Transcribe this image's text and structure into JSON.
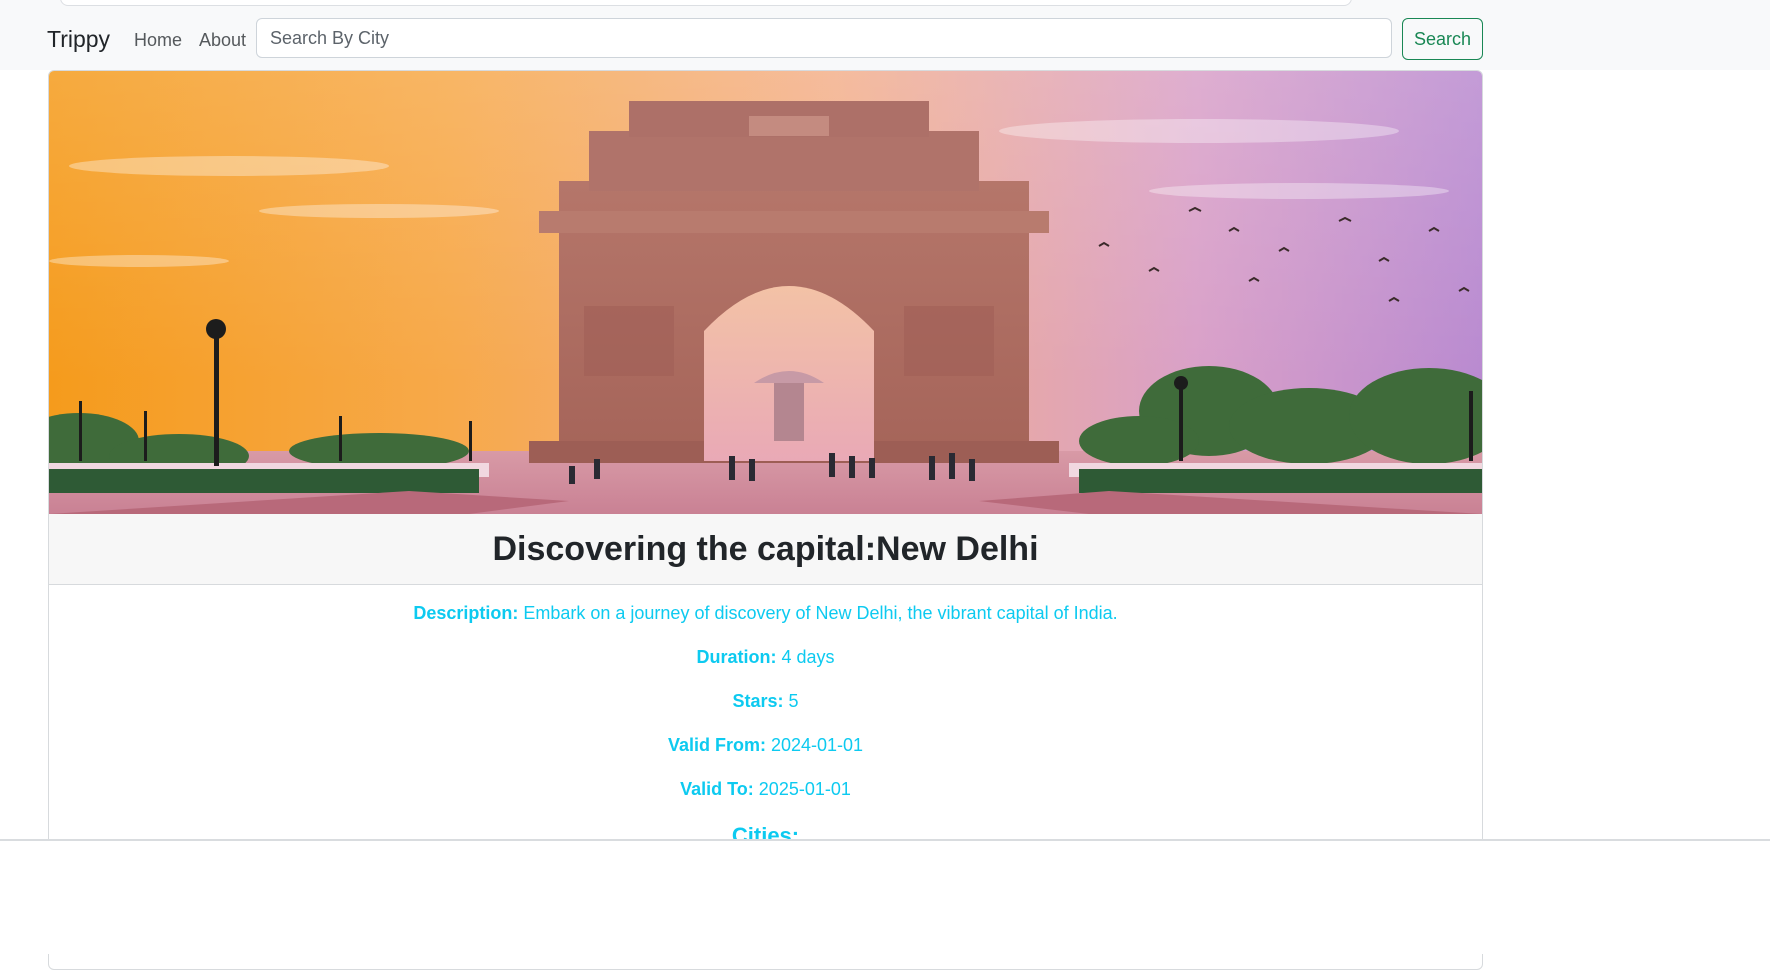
{
  "navbar": {
    "brand": "Trippy",
    "links": [
      {
        "label": "Home"
      },
      {
        "label": "About"
      }
    ],
    "search": {
      "placeholder": "Search By City",
      "button_label": "Search"
    }
  },
  "package": {
    "hero_icon": "india-gate-photo",
    "title": "Discovering the capital:New Delhi",
    "details": [
      {
        "label": "Description:",
        "value": "Embark on a journey of discovery of New Delhi, the vibrant capital of India."
      },
      {
        "label": "Duration:",
        "value": "4 days"
      },
      {
        "label": "Stars:",
        "value": "5"
      },
      {
        "label": "Valid From:",
        "value": "2024-01-01"
      },
      {
        "label": "Valid To:",
        "value": "2025-01-01"
      }
    ],
    "cities_label": "Cities:"
  },
  "colors": {
    "accent": "#0dcaf0",
    "search_button": "#198754",
    "navbar_bg": "#f8f9fa"
  }
}
